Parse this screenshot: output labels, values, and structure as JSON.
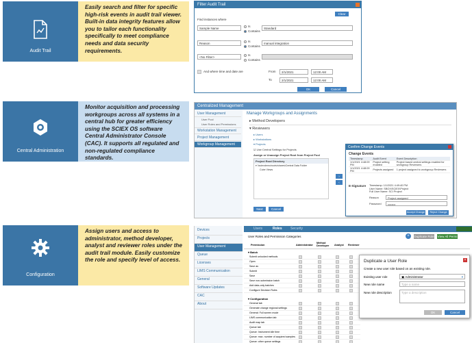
{
  "sections": [
    {
      "label": "Audit Trail",
      "description": "Easily search and filter for specific high-risk events in audit trail viewer. Built-in data integrity features allow you to tailor each functionality specifically to meet compliance needs and data security requirements.",
      "bg": "#fbe9a6"
    },
    {
      "label": "Central Administration",
      "description": "Monitor acquisition and processing workgroups across all systems in a central hub for greater efficiency using the SCIEX OS software Central Administrator Console (CAC). It supports all regulated and non-regulated compliance standards.",
      "bg": "#c7dcef"
    },
    {
      "label": "Configuration",
      "description": "Assign users and access to administrator, method developer, analyst and reviewer roles under the audit trail module. Easily customize the role and specify level of access.",
      "bg": "#fbe9a6"
    }
  ],
  "audit": {
    "title": "Filter Audit Trail",
    "clear": "Clear",
    "find_where": "Find instances where",
    "rows": [
      {
        "field": "Sample Name",
        "is": "Is",
        "contains": "Contains",
        "value": "Standard"
      },
      {
        "field": "Reason",
        "is": "Is",
        "contains": "Contains",
        "value": "manual integration"
      },
      {
        "field": "<No Filter>",
        "is": "Is",
        "contains": "Contains",
        "value": ""
      }
    ],
    "and_where": "And where time and date are",
    "from": "From",
    "to": "To",
    "date": "2/1/2021",
    "time": "12:00 AM",
    "ok": "OK",
    "cancel": "Cancel"
  },
  "cac": {
    "title": "Centralized Management",
    "sidebar": [
      "User Management",
      "User Pool",
      "User Roles and Permissions",
      "Workstation Management",
      "Project Management",
      "Workgroup Management"
    ],
    "heading": "Manage Workgroups and Assignments",
    "method_developers": "Method Developers",
    "reviewers": "Reviewers",
    "subitems": [
      "Users",
      "Workstations",
      "Projects"
    ],
    "use_central": "Use Central Settings for Projects",
    "assign": "Assign or Unassign Project Root from Project Pool",
    "root_dir": "Project Root Directory",
    "root_path": "\\\\sciexdemo\\roots\\shares\\Central Data Folder",
    "sub_root": "Cube Views",
    "next": "Next",
    "cancel": "Cancel",
    "dialog": {
      "title": "Confirm Change Events",
      "change_events": "Change Events",
      "cols": [
        "Timestamp",
        "Audit Event",
        "Event Description"
      ],
      "rows": [
        [
          "1/1/2021 4:48:09 PM",
          "Project setting enabled",
          "Project based central settings enabled for workgroup Reviewers"
        ],
        [
          "1/1/2021 4:48:09 PM",
          "Projects assigned",
          "1 project assigned to workgroup Reviewers"
        ]
      ],
      "esig": "E-Signature",
      "esig_lines": [
        "Timestamp:   1/1/2021 4:49:40 PM",
        "User Name:   SBOX\\SCIEX\\Project",
        "Full User Name:  SCI Project"
      ],
      "reason_label": "Reason",
      "reason_value": "Project assigned",
      "password_label": "Password",
      "password_value": "••••••••",
      "buttons": [
        "Accept Change",
        "Reject Change"
      ]
    }
  },
  "config": {
    "sidebar": [
      "Devices",
      "Projects",
      "User Management",
      "Queue",
      "Licenses",
      "LIMS Communication",
      "General",
      "Software Updates",
      "CAC",
      "About"
    ],
    "active": "User Management",
    "tabs": [
      "Users",
      "Roles",
      "Security"
    ],
    "subtitle": "User Roles and Permission Categories",
    "add_role": "Duplicate Role",
    "view_all": "View All Permi",
    "cols": [
      "Permission",
      "Administrator",
      "Method Developer",
      "Analyst",
      "Reviewer"
    ],
    "group1": "Batch",
    "group1_items": [
      "Submit unlocked methods",
      "Open",
      "Save as",
      "Submit",
      "Save",
      "Save non-submission batch",
      "Add data-only batches",
      "Configure Decision Rules"
    ],
    "group2": "Configuration",
    "group2_items": [
      "General tab",
      "Generate change regional settings",
      "General: Full screen mode",
      "LIMS communication tab",
      "Audit map tab",
      "Queue tab",
      "Queue: Instrument idle time",
      "Queue: max. number of acquired samples",
      "Queue: other queue settings"
    ],
    "dialog": {
      "title": "Duplicate a User Role",
      "subtitle": "Create a new user role based on an existing role.",
      "existing_label": "Existing user role",
      "existing_value": "Administrator",
      "new_name": "New role name",
      "new_name_ph": "Type a name",
      "new_desc": "New role description",
      "new_desc_ph": "Type a description",
      "ok": "OK",
      "cancel": "Cancel"
    }
  }
}
